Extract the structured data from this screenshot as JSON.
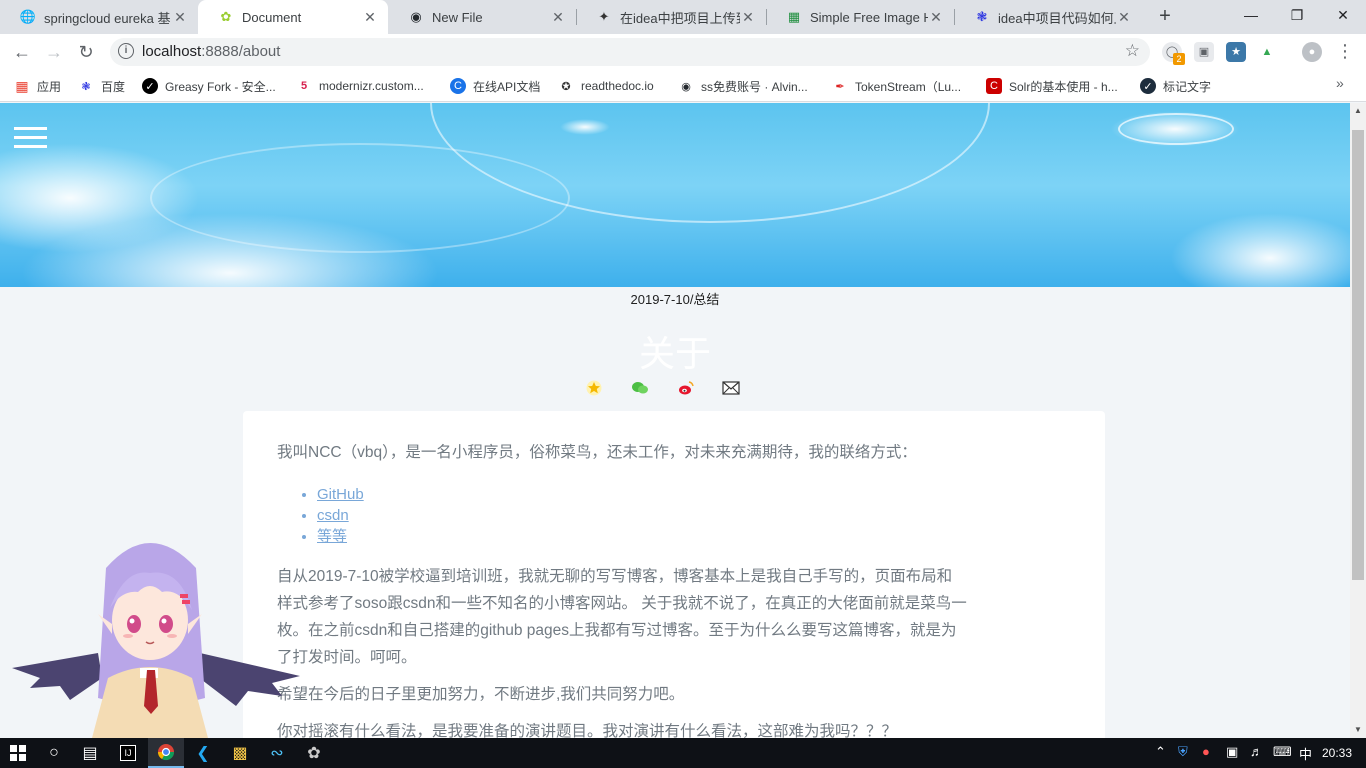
{
  "browser": {
    "tabs": [
      {
        "title": "springcloud eureka 基",
        "icon": "globe-icon",
        "active": false
      },
      {
        "title": "Document",
        "icon": "leaf-icon",
        "active": true
      },
      {
        "title": "New File",
        "icon": "github-icon",
        "active": false
      },
      {
        "title": "在idea中把项目上传到G",
        "icon": "idea-icon",
        "active": false
      },
      {
        "title": "Simple Free Image Ho",
        "icon": "chart-bars-icon",
        "active": false
      },
      {
        "title": "idea中项目代码如何上传",
        "icon": "baidu-paw-icon",
        "active": false
      }
    ],
    "url_host": "localhost",
    "url_path": ":8888/about",
    "extension_badge": "2",
    "bookmarks": [
      {
        "label": "应用",
        "icon": "apps-grid-icon"
      },
      {
        "label": "百度",
        "icon": "baidu-paw-icon"
      },
      {
        "label": "Greasy Fork - 安全...",
        "icon": "greasyfork-icon"
      },
      {
        "label": "modernizr.custom...",
        "icon": "modernizr-icon"
      },
      {
        "label": "在线API文档",
        "icon": "api-doc-icon"
      },
      {
        "label": "readthedoc.io",
        "icon": "readthedocs-icon"
      },
      {
        "label": "ss免费账号 · Alvin...",
        "icon": "github-icon"
      },
      {
        "label": "TokenStream（Lu...",
        "icon": "feather-icon"
      },
      {
        "label": "Solr的基本使用 - h...",
        "icon": "csdn-icon"
      },
      {
        "label": "标记文字",
        "icon": "mark-icon"
      }
    ]
  },
  "page": {
    "date_category": "2019-7-10/总结",
    "title": "关于",
    "social_icons": [
      "star-icon",
      "wechat-icon",
      "weibo-icon",
      "mail-icon"
    ],
    "intro": "我叫NCC（vbq），是一名小程序员，俗称菜鸟，还未工作，对未来充满期待，我的联络方式：",
    "links": [
      "GitHub",
      "csdn",
      "等等"
    ],
    "paragraph1": "自从2019-7-10被学校逼到培训班，我就无聊的写写博客，博客基本上是我自己手写的，页面布局和样式参考了soso跟csdn和一些不知名的小博客网站。 关于我就不说了，在真正的大佬面前就是菜鸟一枚。在之前csdn和自己搭建的github pages上我都有写过博客。至于为什么么要写这篇博客，就是为了打发时间。呵呵。",
    "paragraph2": "希望在今后的日子里更加努力，不断进步,我们共同努力吧。",
    "paragraph3": "你对摇滚有什么看法，是我要准备的演讲题目。我对演讲有什么看法，这部难为我吗？？？"
  },
  "taskbar": {
    "time": "20:33",
    "ime": "中",
    "icons": [
      "windows-start-icon",
      "search-circle-icon",
      "task-view-icon",
      "intellij-icon",
      "chrome-icon",
      "vscode-icon",
      "file-explorer-icon",
      "sublime-icon",
      "mascot-app-icon"
    ]
  },
  "colors": {
    "banner": "#5cc4ef",
    "link": "#79a7d8",
    "body_text": "#717a82"
  }
}
